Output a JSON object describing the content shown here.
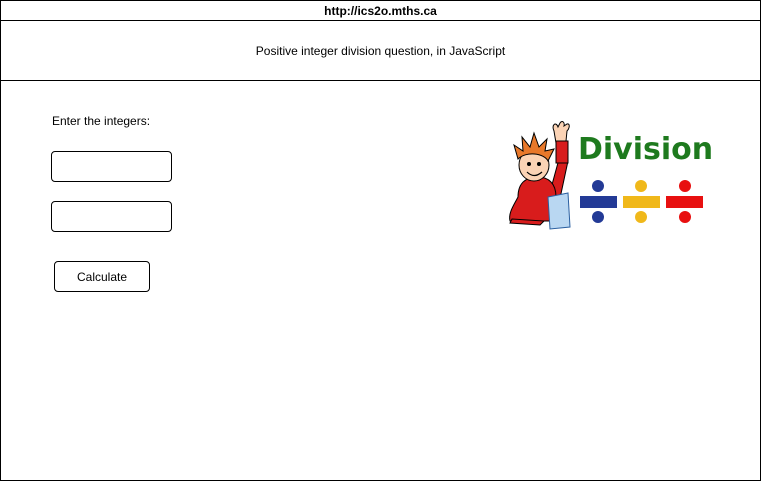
{
  "browser": {
    "url": "http://ics2o.mths.ca"
  },
  "header": {
    "title": "Positive integer division question, in JavaScript"
  },
  "form": {
    "prompt": "Enter the integers:",
    "input_a": {
      "value": "",
      "placeholder": ""
    },
    "input_b": {
      "value": "",
      "placeholder": ""
    },
    "calculate_label": "Calculate"
  },
  "logo": {
    "text": "Division",
    "colors": {
      "word": "#1e7a1e",
      "bar_left": "#233a96",
      "bar_middle": "#f0b81a",
      "bar_right": "#e81010",
      "shirt": "#d81c1c",
      "hair": "#e8782a"
    }
  }
}
